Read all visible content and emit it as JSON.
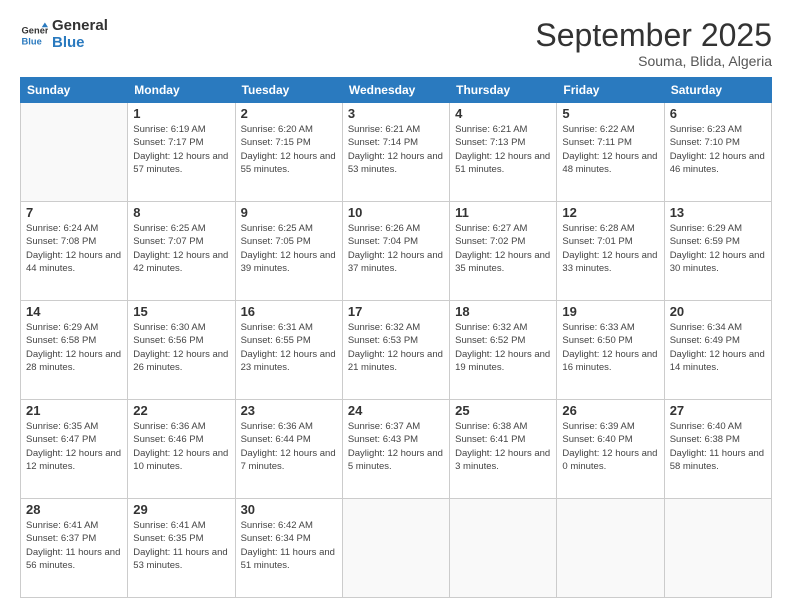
{
  "logo": {
    "general": "General",
    "blue": "Blue"
  },
  "header": {
    "month": "September 2025",
    "location": "Souma, Blida, Algeria"
  },
  "days_of_week": [
    "Sunday",
    "Monday",
    "Tuesday",
    "Wednesday",
    "Thursday",
    "Friday",
    "Saturday"
  ],
  "weeks": [
    [
      null,
      {
        "day": 1,
        "sunrise": "6:19 AM",
        "sunset": "7:17 PM",
        "daylight": "12 hours and 57 minutes."
      },
      {
        "day": 2,
        "sunrise": "6:20 AM",
        "sunset": "7:15 PM",
        "daylight": "12 hours and 55 minutes."
      },
      {
        "day": 3,
        "sunrise": "6:21 AM",
        "sunset": "7:14 PM",
        "daylight": "12 hours and 53 minutes."
      },
      {
        "day": 4,
        "sunrise": "6:21 AM",
        "sunset": "7:13 PM",
        "daylight": "12 hours and 51 minutes."
      },
      {
        "day": 5,
        "sunrise": "6:22 AM",
        "sunset": "7:11 PM",
        "daylight": "12 hours and 48 minutes."
      },
      {
        "day": 6,
        "sunrise": "6:23 AM",
        "sunset": "7:10 PM",
        "daylight": "12 hours and 46 minutes."
      }
    ],
    [
      {
        "day": 7,
        "sunrise": "6:24 AM",
        "sunset": "7:08 PM",
        "daylight": "12 hours and 44 minutes."
      },
      {
        "day": 8,
        "sunrise": "6:25 AM",
        "sunset": "7:07 PM",
        "daylight": "12 hours and 42 minutes."
      },
      {
        "day": 9,
        "sunrise": "6:25 AM",
        "sunset": "7:05 PM",
        "daylight": "12 hours and 39 minutes."
      },
      {
        "day": 10,
        "sunrise": "6:26 AM",
        "sunset": "7:04 PM",
        "daylight": "12 hours and 37 minutes."
      },
      {
        "day": 11,
        "sunrise": "6:27 AM",
        "sunset": "7:02 PM",
        "daylight": "12 hours and 35 minutes."
      },
      {
        "day": 12,
        "sunrise": "6:28 AM",
        "sunset": "7:01 PM",
        "daylight": "12 hours and 33 minutes."
      },
      {
        "day": 13,
        "sunrise": "6:29 AM",
        "sunset": "6:59 PM",
        "daylight": "12 hours and 30 minutes."
      }
    ],
    [
      {
        "day": 14,
        "sunrise": "6:29 AM",
        "sunset": "6:58 PM",
        "daylight": "12 hours and 28 minutes."
      },
      {
        "day": 15,
        "sunrise": "6:30 AM",
        "sunset": "6:56 PM",
        "daylight": "12 hours and 26 minutes."
      },
      {
        "day": 16,
        "sunrise": "6:31 AM",
        "sunset": "6:55 PM",
        "daylight": "12 hours and 23 minutes."
      },
      {
        "day": 17,
        "sunrise": "6:32 AM",
        "sunset": "6:53 PM",
        "daylight": "12 hours and 21 minutes."
      },
      {
        "day": 18,
        "sunrise": "6:32 AM",
        "sunset": "6:52 PM",
        "daylight": "12 hours and 19 minutes."
      },
      {
        "day": 19,
        "sunrise": "6:33 AM",
        "sunset": "6:50 PM",
        "daylight": "12 hours and 16 minutes."
      },
      {
        "day": 20,
        "sunrise": "6:34 AM",
        "sunset": "6:49 PM",
        "daylight": "12 hours and 14 minutes."
      }
    ],
    [
      {
        "day": 21,
        "sunrise": "6:35 AM",
        "sunset": "6:47 PM",
        "daylight": "12 hours and 12 minutes."
      },
      {
        "day": 22,
        "sunrise": "6:36 AM",
        "sunset": "6:46 PM",
        "daylight": "12 hours and 10 minutes."
      },
      {
        "day": 23,
        "sunrise": "6:36 AM",
        "sunset": "6:44 PM",
        "daylight": "12 hours and 7 minutes."
      },
      {
        "day": 24,
        "sunrise": "6:37 AM",
        "sunset": "6:43 PM",
        "daylight": "12 hours and 5 minutes."
      },
      {
        "day": 25,
        "sunrise": "6:38 AM",
        "sunset": "6:41 PM",
        "daylight": "12 hours and 3 minutes."
      },
      {
        "day": 26,
        "sunrise": "6:39 AM",
        "sunset": "6:40 PM",
        "daylight": "12 hours and 0 minutes."
      },
      {
        "day": 27,
        "sunrise": "6:40 AM",
        "sunset": "6:38 PM",
        "daylight": "11 hours and 58 minutes."
      }
    ],
    [
      {
        "day": 28,
        "sunrise": "6:41 AM",
        "sunset": "6:37 PM",
        "daylight": "11 hours and 56 minutes."
      },
      {
        "day": 29,
        "sunrise": "6:41 AM",
        "sunset": "6:35 PM",
        "daylight": "11 hours and 53 minutes."
      },
      {
        "day": 30,
        "sunrise": "6:42 AM",
        "sunset": "6:34 PM",
        "daylight": "11 hours and 51 minutes."
      },
      null,
      null,
      null,
      null
    ]
  ],
  "cell_labels": {
    "sunrise": "Sunrise:",
    "sunset": "Sunset:",
    "daylight": "Daylight:"
  }
}
